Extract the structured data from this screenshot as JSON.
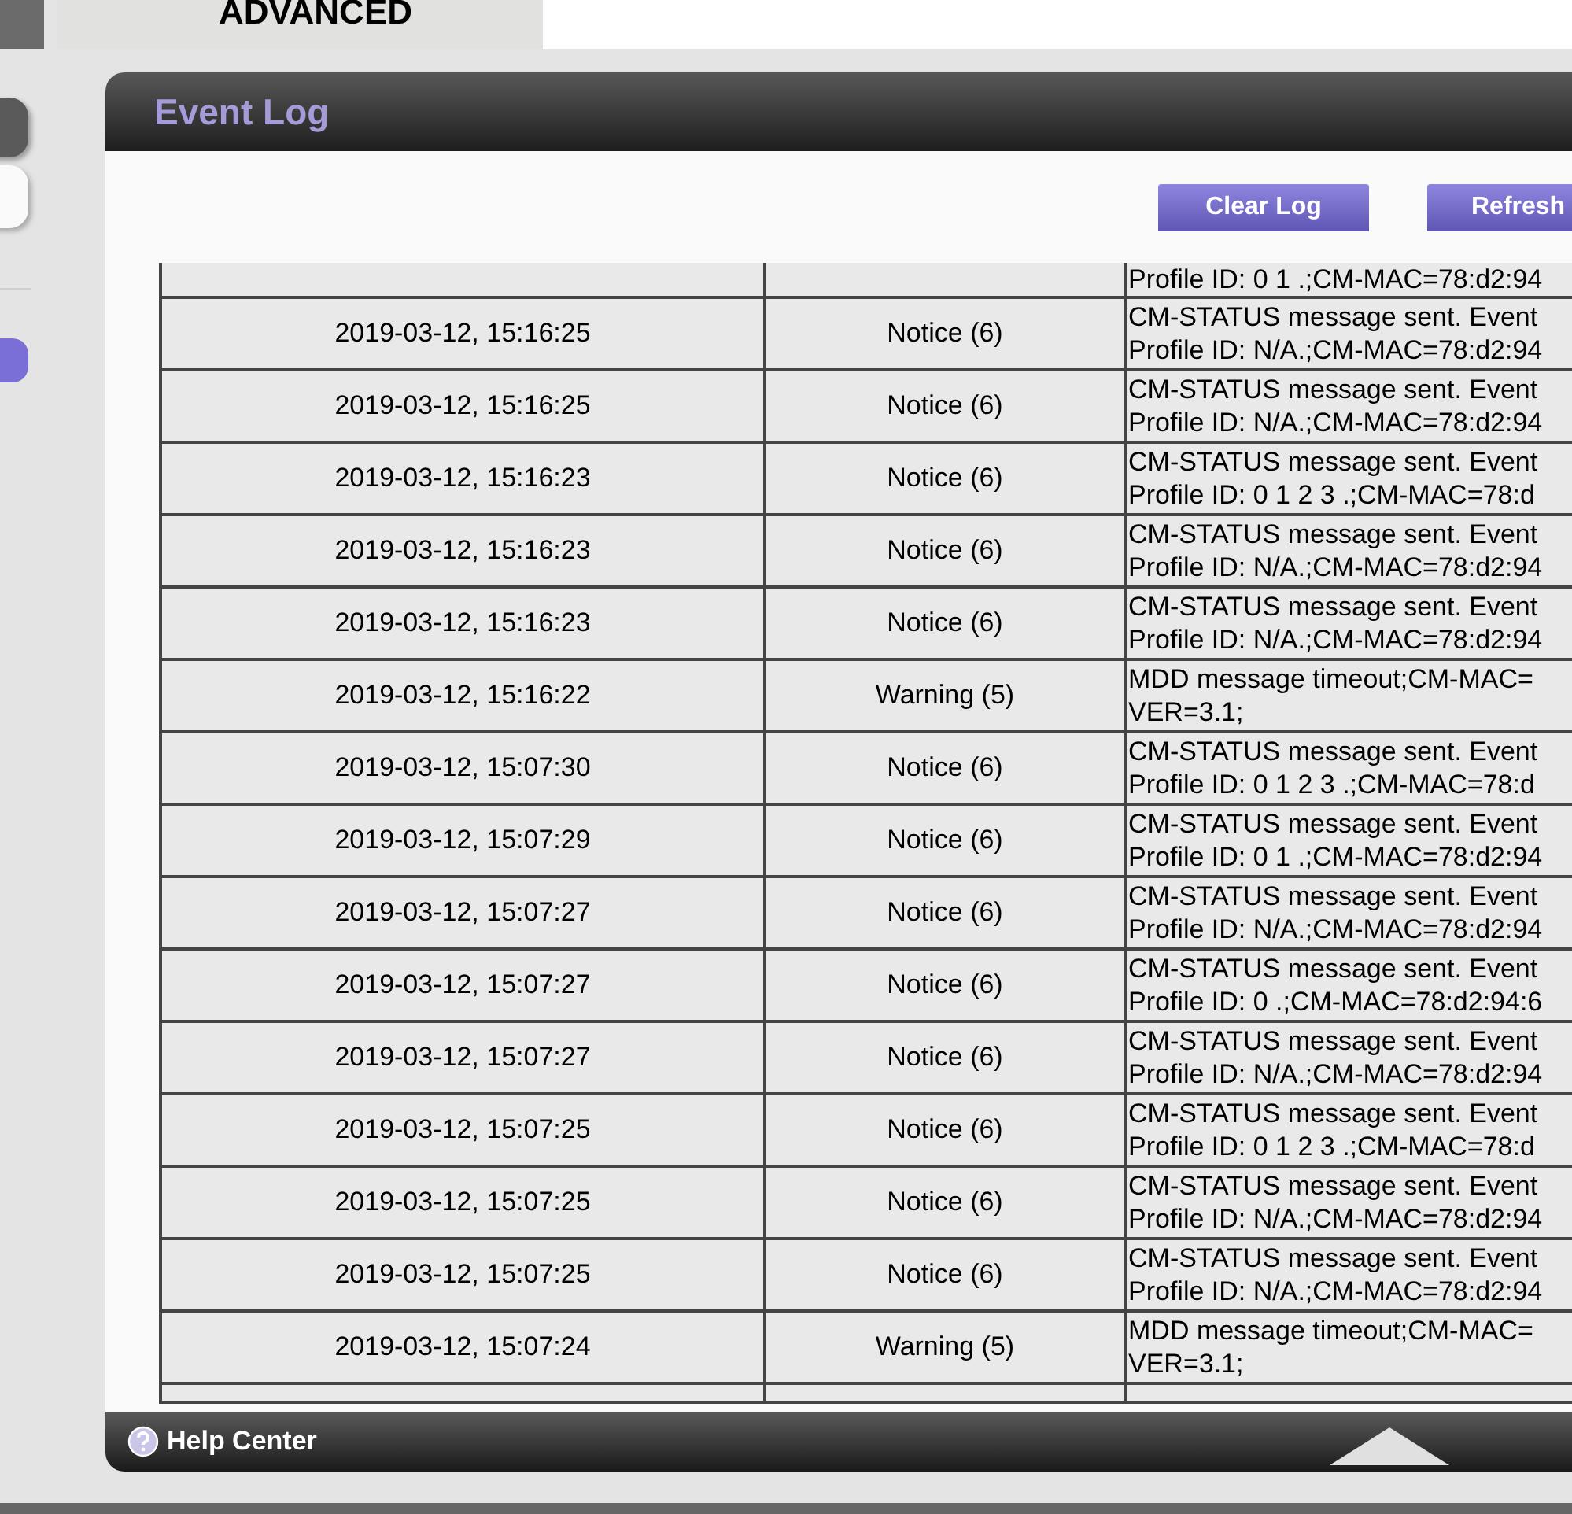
{
  "top_tab": {
    "label": "ADVANCED"
  },
  "panel": {
    "title": "Event Log",
    "buttons": [
      "Clear Log",
      "Refresh"
    ]
  },
  "log_rows": [
    {
      "kind": "partial",
      "message_lines": [
        "Profile ID: 0 1 .;CM-MAC=78:d2:94"
      ]
    },
    {
      "kind": "full",
      "time": "2019-03-12, 15:16:25",
      "level": "Notice (6)",
      "message_lines": [
        "CM-STATUS message sent. Event",
        "Profile ID: N/A.;CM-MAC=78:d2:94"
      ]
    },
    {
      "kind": "full",
      "time": "2019-03-12, 15:16:25",
      "level": "Notice (6)",
      "message_lines": [
        "CM-STATUS message sent. Event",
        "Profile ID: N/A.;CM-MAC=78:d2:94"
      ]
    },
    {
      "kind": "full",
      "time": "2019-03-12, 15:16:23",
      "level": "Notice (6)",
      "message_lines": [
        "CM-STATUS message sent. Event",
        "Profile ID: 0 1 2 3 .;CM-MAC=78:d"
      ]
    },
    {
      "kind": "full",
      "time": "2019-03-12, 15:16:23",
      "level": "Notice (6)",
      "message_lines": [
        "CM-STATUS message sent. Event",
        "Profile ID: N/A.;CM-MAC=78:d2:94"
      ]
    },
    {
      "kind": "full",
      "time": "2019-03-12, 15:16:23",
      "level": "Notice (6)",
      "message_lines": [
        "CM-STATUS message sent. Event",
        "Profile ID: N/A.;CM-MAC=78:d2:94"
      ]
    },
    {
      "kind": "full",
      "time": "2019-03-12, 15:16:22",
      "level": "Warning (5)",
      "message_lines": [
        "MDD message timeout;CM-MAC=",
        "VER=3.1;"
      ]
    },
    {
      "kind": "full",
      "time": "2019-03-12, 15:07:30",
      "level": "Notice (6)",
      "message_lines": [
        "CM-STATUS message sent. Event",
        "Profile ID: 0 1 2 3 .;CM-MAC=78:d"
      ]
    },
    {
      "kind": "full",
      "time": "2019-03-12, 15:07:29",
      "level": "Notice (6)",
      "message_lines": [
        "CM-STATUS message sent. Event",
        "Profile ID: 0 1 .;CM-MAC=78:d2:94"
      ]
    },
    {
      "kind": "full",
      "time": "2019-03-12, 15:07:27",
      "level": "Notice (6)",
      "message_lines": [
        "CM-STATUS message sent. Event",
        "Profile ID: N/A.;CM-MAC=78:d2:94"
      ]
    },
    {
      "kind": "full",
      "time": "2019-03-12, 15:07:27",
      "level": "Notice (6)",
      "message_lines": [
        "CM-STATUS message sent. Event",
        "Profile ID: 0 .;CM-MAC=78:d2:94:6"
      ]
    },
    {
      "kind": "full",
      "time": "2019-03-12, 15:07:27",
      "level": "Notice (6)",
      "message_lines": [
        "CM-STATUS message sent. Event",
        "Profile ID: N/A.;CM-MAC=78:d2:94"
      ]
    },
    {
      "kind": "full",
      "time": "2019-03-12, 15:07:25",
      "level": "Notice (6)",
      "message_lines": [
        "CM-STATUS message sent. Event",
        "Profile ID: 0 1 2 3 .;CM-MAC=78:d"
      ]
    },
    {
      "kind": "full",
      "time": "2019-03-12, 15:07:25",
      "level": "Notice (6)",
      "message_lines": [
        "CM-STATUS message sent. Event",
        "Profile ID: N/A.;CM-MAC=78:d2:94"
      ]
    },
    {
      "kind": "full",
      "time": "2019-03-12, 15:07:25",
      "level": "Notice (6)",
      "message_lines": [
        "CM-STATUS message sent. Event",
        "Profile ID: N/A.;CM-MAC=78:d2:94"
      ]
    },
    {
      "kind": "full",
      "time": "2019-03-12, 15:07:24",
      "level": "Warning (5)",
      "message_lines": [
        "MDD message timeout;CM-MAC=",
        "VER=3.1;"
      ]
    }
  ],
  "footer": {
    "label": "Help Center"
  }
}
